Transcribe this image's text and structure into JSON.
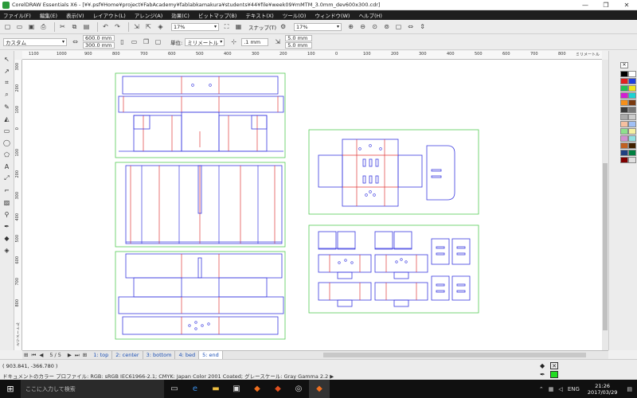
{
  "window": {
    "title": "CorelDRAW Essentials X6 - [¥¥.psf¥Home¥project¥FabAcademy¥fablabkamakura¥students¥44¥file¥week09¥mMTM_3.0mm_dev600x300.cdr]",
    "minimize": "—",
    "maximize": "❐",
    "close": "✕"
  },
  "menu": [
    "ファイル(F)",
    "編集(E)",
    "表示(V)",
    "レイアウト(L)",
    "アレンジ(A)",
    "効果(C)",
    "ビットマップ(B)",
    "テキスト(X)",
    "ツール(O)",
    "ウィンドウ(W)",
    "ヘルプ(H)"
  ],
  "toolbar1": {
    "zoom": "17%",
    "snap_label": "スナップ(T)",
    "zoom2": "17%"
  },
  "toolbar2": {
    "preset": "カスタム",
    "width": "600.0 mm",
    "height": "300.0 mm",
    "units_label": "単位:",
    "units": "ミリメートル",
    "nudge": ".1 mm",
    "dup_x": "5.0 mm",
    "dup_y": "5.0 mm"
  },
  "ruler": {
    "h_labels": [
      "1100",
      "1000",
      "900",
      "800",
      "700",
      "600",
      "500",
      "400",
      "300",
      "200",
      "100",
      "0",
      "100",
      "200",
      "300",
      "400",
      "500",
      "600",
      "700",
      "800"
    ],
    "h_unit": "ミリメートル",
    "v_labels": [
      "300",
      "200",
      "100",
      "0",
      "100",
      "200",
      "300",
      "400",
      "500",
      "600",
      "700",
      "800"
    ],
    "v_unit": "ミリメートル"
  },
  "pages": {
    "counter": "5 / 5",
    "tabs": [
      "1: top",
      "2: center",
      "3: bottom",
      "4: bed",
      "5: end"
    ],
    "active_index": 4
  },
  "status": {
    "coords": "( 903.841, -366.780 )",
    "profile": "ドキュメントのカラー プロファイル: RGB: sRGB IEC61966-2.1; CMYK: Japan Color 2001 Coated; グレースケール: Gray Gamma 2.2 ▶"
  },
  "taskbar": {
    "search_placeholder": "ここに入力して検索",
    "lang": "ENG",
    "time": "21:26",
    "date": "2017/03/29"
  },
  "colors": {
    "cut": "#3a3ae0",
    "fold": "#e03a3a",
    "page": "#55cc55"
  },
  "palette": [
    "#000000",
    "#ffffff",
    "#e32020",
    "#1f3fe0",
    "#22c055",
    "#f2e41a",
    "#d21fd2",
    "#1fd2d2",
    "#f58f1a",
    "#7a3a10",
    "#3a3a3a",
    "#777777",
    "#aaaaaa",
    "#cccccc",
    "#f6c0a0",
    "#a0c0f6",
    "#8de08d",
    "#f6f0a0",
    "#d090d0",
    "#90e0e0",
    "#c06020",
    "#402000",
    "#204080",
    "#008040",
    "#800000",
    "#e0e0e0"
  ]
}
